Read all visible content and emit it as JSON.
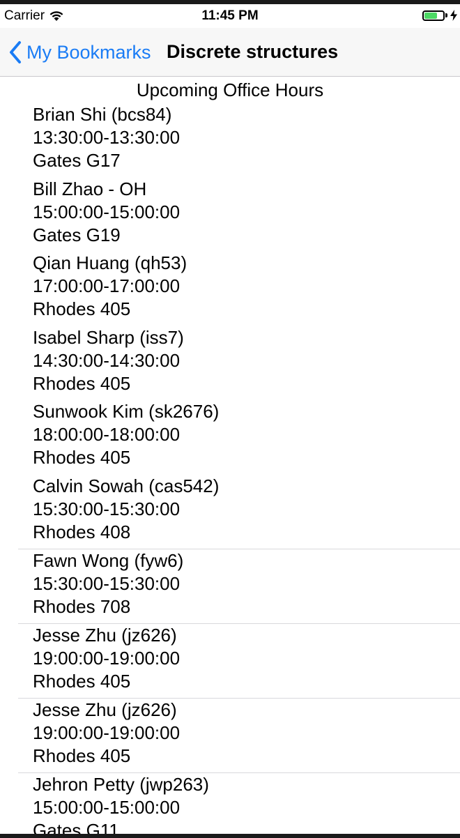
{
  "status_bar": {
    "carrier": "Carrier",
    "time": "11:45 PM"
  },
  "nav": {
    "back_label": "My Bookmarks",
    "title": "Discrete structures"
  },
  "colors": {
    "accent": "#1a7cf5",
    "battery": "#4cd964"
  },
  "section_title": "Upcoming Office Hours",
  "office_hours": [
    {
      "name": "Brian Shi (bcs84)",
      "time": "13:30:00-13:30:00",
      "location": "Gates G17"
    },
    {
      "name": "Bill Zhao - OH",
      "time": "15:00:00-15:00:00",
      "location": "Gates G19"
    },
    {
      "name": "Qian Huang (qh53)",
      "time": "17:00:00-17:00:00",
      "location": "Rhodes 405"
    },
    {
      "name": "Isabel Sharp (iss7)",
      "time": "14:30:00-14:30:00",
      "location": "Rhodes 405"
    },
    {
      "name": "Sunwook Kim (sk2676)",
      "time": "18:00:00-18:00:00",
      "location": "Rhodes 405"
    },
    {
      "name": "Calvin Sowah (cas542)",
      "time": "15:30:00-15:30:00",
      "location": "Rhodes 408"
    },
    {
      "name": "Fawn Wong (fyw6)",
      "time": "15:30:00-15:30:00",
      "location": "Rhodes 708"
    },
    {
      "name": "Jesse Zhu (jz626)",
      "time": "19:00:00-19:00:00",
      "location": "Rhodes 405"
    },
    {
      "name": "Jesse Zhu (jz626)",
      "time": "19:00:00-19:00:00",
      "location": "Rhodes 405"
    },
    {
      "name": "Jehron Petty (jwp263)",
      "time": "15:00:00-15:00:00",
      "location": "Gates G11"
    }
  ]
}
